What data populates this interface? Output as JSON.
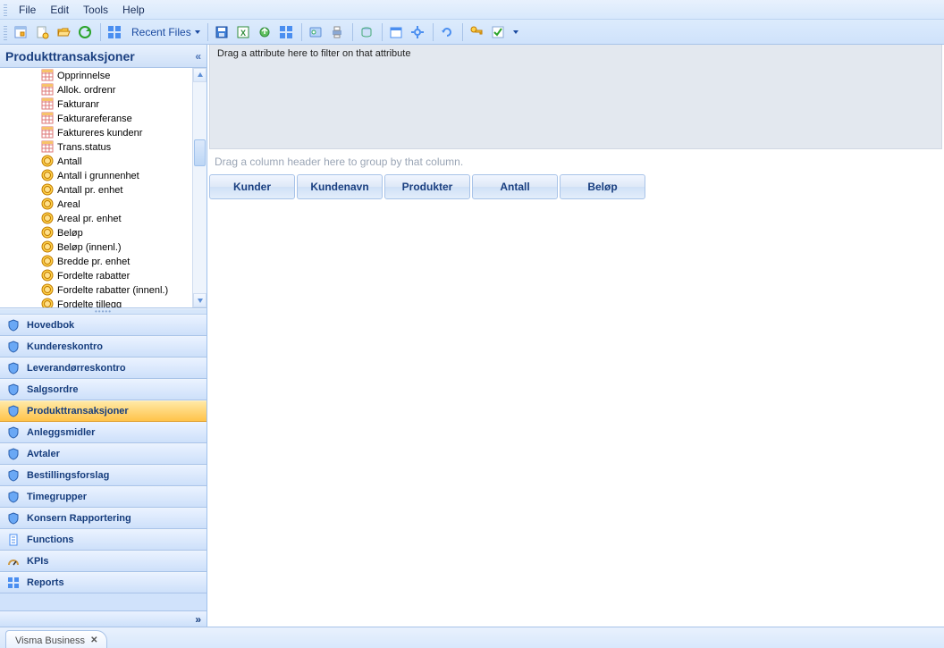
{
  "menu": {
    "items": [
      "File",
      "Edit",
      "Tools",
      "Help"
    ]
  },
  "toolbar": {
    "recent_label": "Recent Files"
  },
  "sidebar": {
    "header": "Produkttransaksjoner",
    "tree_items": [
      "Opprinnelse",
      "Allok. ordrenr",
      "Fakturanr",
      "Fakturareferanse",
      "Faktureres kundenr",
      "Trans.status",
      "Antall",
      "Antall i grunnenhet",
      "Antall pr. enhet",
      "Areal",
      "Areal pr. enhet",
      "Beløp",
      "Beløp (innenl.)",
      "Bredde pr. enhet",
      "Fordelte rabatter",
      "Fordelte rabatter (innenl.)",
      "Fordelte tillegg"
    ],
    "tree_item_icons": [
      "grid",
      "grid",
      "grid",
      "grid",
      "grid",
      "grid",
      "coin",
      "coin",
      "coin",
      "coin",
      "coin",
      "coin",
      "coin",
      "coin",
      "coin",
      "coin",
      "coin"
    ],
    "nav": [
      {
        "label": "Hovedbok",
        "icon": "shield",
        "active": false
      },
      {
        "label": "Kundereskontro",
        "icon": "shield",
        "active": false
      },
      {
        "label": "Leverandørreskontro",
        "icon": "shield",
        "active": false
      },
      {
        "label": "Salgsordre",
        "icon": "shield",
        "active": false
      },
      {
        "label": "Produkttransaksjoner",
        "icon": "shield",
        "active": true
      },
      {
        "label": "Anleggsmidler",
        "icon": "shield",
        "active": false
      },
      {
        "label": "Avtaler",
        "icon": "shield",
        "active": false
      },
      {
        "label": "Bestillingsforslag",
        "icon": "shield",
        "active": false
      },
      {
        "label": "Timegrupper",
        "icon": "shield",
        "active": false
      },
      {
        "label": "Konsern Rapportering",
        "icon": "shield",
        "active": false
      },
      {
        "label": "Functions",
        "icon": "doc",
        "active": false
      },
      {
        "label": "KPIs",
        "icon": "gauge",
        "active": false
      },
      {
        "label": "Reports",
        "icon": "report",
        "active": false
      }
    ]
  },
  "main": {
    "filter_hint": "Drag a attribute here to filter on that attribute",
    "group_hint": "Drag a column header here to group by that column.",
    "columns": [
      "Kunder",
      "Kundenavn",
      "Produkter",
      "Antall",
      "Beløp"
    ]
  },
  "tabs": [
    {
      "label": "Visma Business"
    }
  ]
}
